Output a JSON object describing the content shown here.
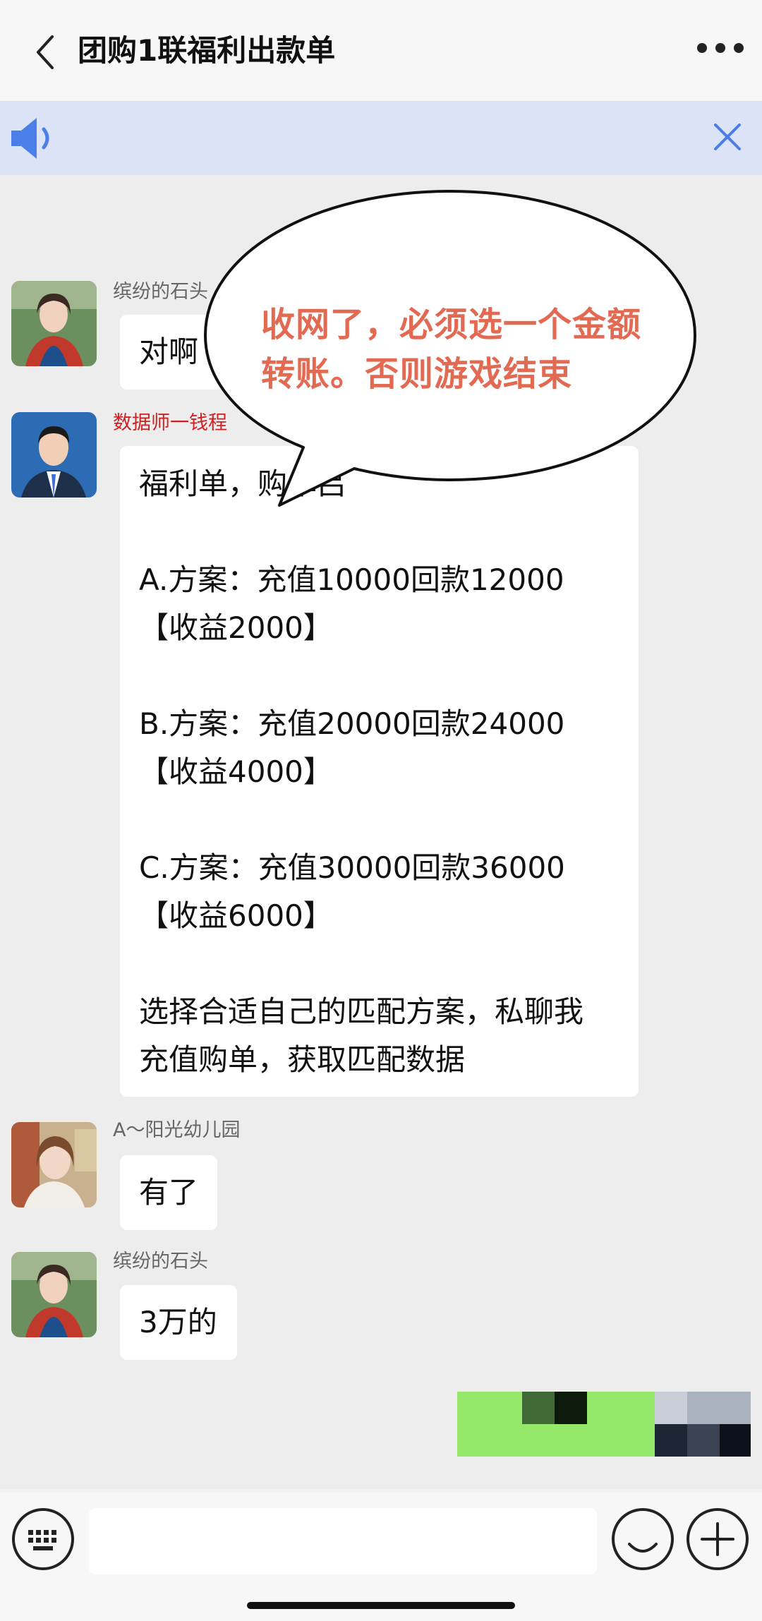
{
  "header": {
    "title": "团购1联福利出款单"
  },
  "messages": [
    {
      "sender": "缤纷的石头",
      "text": "对啊"
    },
    {
      "sender": "数据师一钱程",
      "text": "福利单，购单吕\n\nA.方案：充值10000回款12000\n【收益2000】\n\nB.方案：充值20000回款24000\n【收益4000】\n\nC.方案：充值30000回款36000\n【收益6000】\n\n选择合适自己的匹配方案，私聊我\n充值购单，获取匹配数据"
    },
    {
      "sender": "A～阳光幼儿园",
      "text": "有了"
    },
    {
      "sender": "缤纷的石头",
      "text": "3万的"
    }
  ],
  "callout": {
    "text": "收网了，必须选一个金额转账。否则游戏结束"
  },
  "colors": {
    "header_bg": "#f7f7f7",
    "banner_bg": "#dde3f6",
    "chat_bg": "#ededed",
    "callout_text": "#e36a52",
    "sender_red": "#d21f1f",
    "icon_blue": "#4a7ee8"
  },
  "icons": [
    "back-icon",
    "more-icon",
    "speaker-icon",
    "close-icon",
    "keyboard-icon",
    "emoji-icon",
    "plus-icon"
  ]
}
